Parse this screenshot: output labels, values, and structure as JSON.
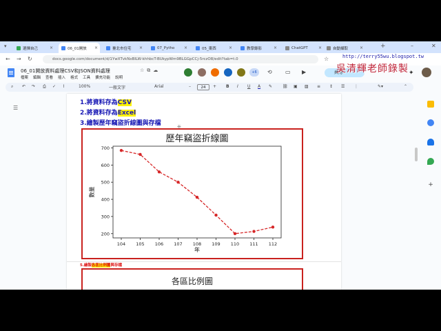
{
  "tabs": [
    {
      "label": "選擇自己",
      "fav": "#34a853",
      "active": false
    },
    {
      "label": "06_01開放",
      "fav": "#4285f4",
      "active": true
    },
    {
      "label": "臺北市住宅",
      "fav": "#4285f4",
      "active": false
    },
    {
      "label": "07_Pytho",
      "fav": "#4285f4",
      "active": false
    },
    {
      "label": "05_東西",
      "fav": "#4285f4",
      "active": false
    },
    {
      "label": "教學錄影",
      "fav": "#4285f4",
      "active": false
    },
    {
      "label": "ChatGPT",
      "fav": "#888888",
      "active": false
    },
    {
      "label": "自動擷取",
      "fav": "#888888",
      "active": false
    }
  ],
  "browser": {
    "url": "docs.google.com/document/d/1YwXTvkNxBlLW-khhbcT-BUkypWm9BLGGpCCj-5rczO8/edit?tab=t.0",
    "new_tab": "+"
  },
  "watermark": {
    "url": "http://terry55wu.blogspot.tw",
    "name": "吳清輝老師錄製"
  },
  "doc": {
    "title": "06_01開放資料處理CSV和JSON資料處理",
    "menus": [
      "檔案",
      "編輯",
      "查看",
      "插入",
      "格式",
      "工具",
      "擴充功能",
      "說明"
    ],
    "share_label": "共用",
    "avatar_count": "+6"
  },
  "toolbar": {
    "zoom": "100%",
    "style": "一般文字",
    "font": "Arial",
    "font_size": "24",
    "bold": "B",
    "italic": "I",
    "underline": "U",
    "text_color": "A"
  },
  "content": {
    "h1_prefix": "1.將資料存為",
    "h1_hl": "CSV",
    "h2_prefix": "2.將資料存為",
    "h2_hl": "Excel",
    "h3": "3.繪製歷年竊盜折線圖與存檔",
    "h4_prefix": "5.繪製",
    "h4_hl": "各區比例圖",
    "h4_suffix": "與存檔",
    "chart2_title": "各區比例圖"
  },
  "chart_data": {
    "type": "line",
    "title": "歷年竊盜折線圖",
    "xlabel": "年",
    "ylabel": "數量",
    "categories": [
      "104",
      "105",
      "106",
      "107",
      "108",
      "109",
      "110",
      "111",
      "112"
    ],
    "values": [
      685,
      662,
      560,
      500,
      412,
      308,
      200,
      213,
      238
    ],
    "ylim": [
      175,
      710
    ],
    "yticks": [
      200,
      300,
      400,
      500,
      600,
      700
    ],
    "color": "#d62728",
    "line_style": "dashed",
    "marker": "circle"
  }
}
